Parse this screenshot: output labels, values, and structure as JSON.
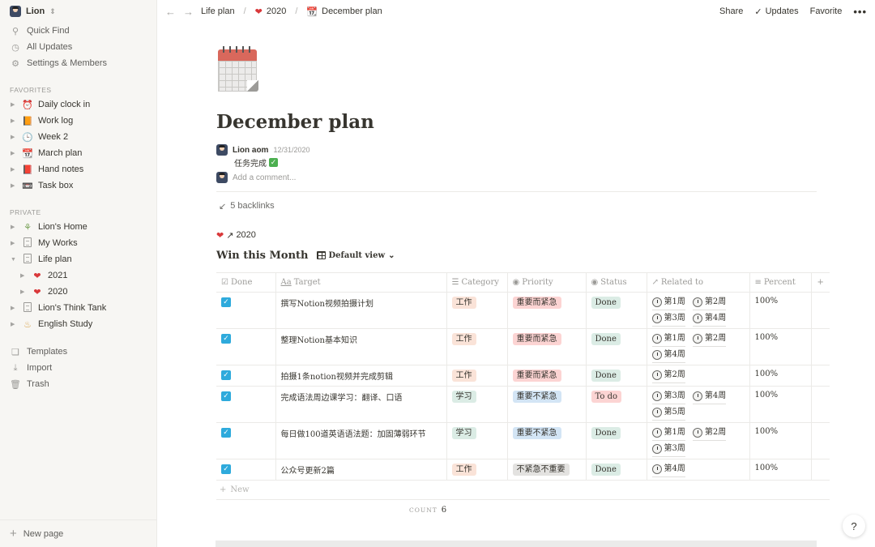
{
  "sidebar": {
    "workspace": "Lion",
    "top_items": [
      {
        "icon": "search-icon",
        "label": "Quick Find"
      },
      {
        "icon": "clock-icon",
        "label": "All Updates"
      },
      {
        "icon": "gear-icon",
        "label": "Settings & Members"
      }
    ],
    "favorites_label": "FAVORITES",
    "favorites": [
      {
        "emoji": "⏰",
        "label": "Daily clock in"
      },
      {
        "emoji": "📙",
        "label": "Work log"
      },
      {
        "emoji": "🕒",
        "label": "Week 2"
      },
      {
        "emoji": "📆",
        "label": "March plan"
      },
      {
        "emoji": "📕",
        "label": "Hand notes"
      },
      {
        "emoji": "📼",
        "label": "Task box"
      }
    ],
    "private_label": "PRIVATE",
    "private": [
      {
        "label": "Lion's Home"
      },
      {
        "label": "My Works"
      },
      {
        "label": "Life plan"
      },
      {
        "label": "2021"
      },
      {
        "label": "2020"
      },
      {
        "label": "Lion's Think Tank"
      },
      {
        "label": "English Study"
      }
    ],
    "bottom_items": [
      {
        "label": "Templates"
      },
      {
        "label": "Import"
      },
      {
        "label": "Trash"
      }
    ],
    "new_page": "New page"
  },
  "topbar": {
    "breadcrumbs": [
      "Life plan",
      "2020",
      "December plan"
    ],
    "share": "Share",
    "updates": "Updates",
    "favorite": "Favorite"
  },
  "page": {
    "title": "December plan",
    "comment": {
      "author": "Lion aom",
      "date": "12/31/2020",
      "text": "任务完成"
    },
    "add_comment_placeholder": "Add a comment...",
    "backlinks": "5 backlinks",
    "relation_ref": "2020"
  },
  "database": {
    "title": "Win this Month",
    "view": "Default view",
    "columns": [
      "Done",
      "Target",
      "Category",
      "Priority",
      "Status",
      "Related to",
      "Percent"
    ],
    "rows": [
      {
        "target": "撰写Notion视频拍摄计划",
        "category": "工作",
        "priority": "重要而紧急",
        "status": "Done",
        "related": [
          "第1周",
          "第2周",
          "第3周",
          "第4周"
        ],
        "percent": "100%"
      },
      {
        "target": "整理Notion基本知识",
        "category": "工作",
        "priority": "重要而紧急",
        "status": "Done",
        "related": [
          "第1周",
          "第2周",
          "第4周"
        ],
        "percent": "100%"
      },
      {
        "target": "拍摄1条notion视频并完成剪辑",
        "category": "工作",
        "priority": "重要而紧急",
        "status": "Done",
        "related": [
          "第2周"
        ],
        "percent": "100%"
      },
      {
        "target": "完成语法周边课学习：翻译、口语",
        "category": "学习",
        "priority": "重要不紧急",
        "status": "To do",
        "related": [
          "第3周",
          "第4周",
          "第5周"
        ],
        "percent": "100%"
      },
      {
        "target": "每日做100道英语语法题：加固薄弱环节",
        "category": "学习",
        "priority": "重要不紧急",
        "status": "Done",
        "related": [
          "第1周",
          "第2周",
          "第3周"
        ],
        "percent": "100%"
      },
      {
        "target": "公众号更新2篇",
        "category": "工作",
        "priority": "不紧急不重要",
        "status": "Done",
        "related": [
          "第4周"
        ],
        "percent": "100%"
      }
    ],
    "new_label": "New",
    "count_label": "COUNT",
    "count_value": "6"
  },
  "colors": {
    "checkbox": "#2eaadc",
    "tag_work_bg": "#fae3d8",
    "tag_study_bg": "#dbece5",
    "priority_urgent_bg": "#fcd4d3",
    "priority_important_bg": "#d3e5f5",
    "priority_low_bg": "#e3e2e0",
    "status_done_bg": "#dbece5",
    "status_todo_bg": "#fcd4d3"
  },
  "help": "?"
}
